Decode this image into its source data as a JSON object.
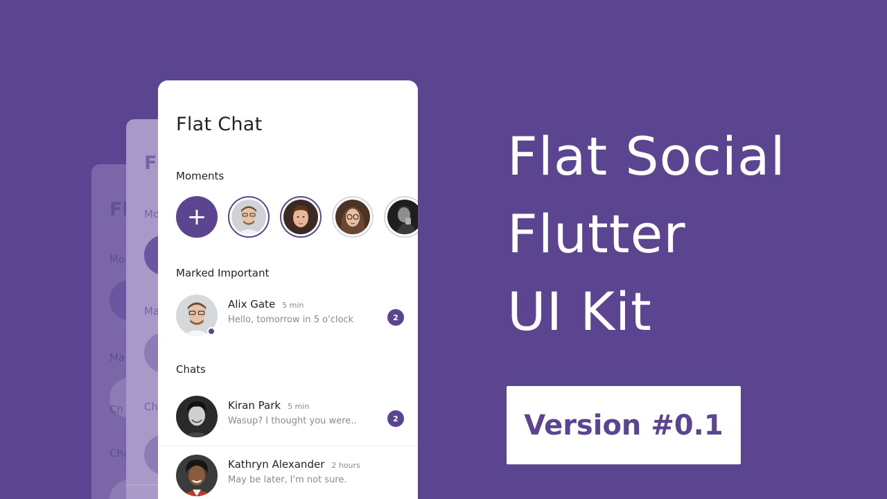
{
  "ghost_back": {
    "title_fragment": "Fl",
    "labels": [
      "Mo",
      "Ma",
      "Ch",
      "Cha"
    ]
  },
  "ghost_mid": {
    "title_fragment": "F",
    "labels": [
      "Mo",
      "Ma",
      "Ch"
    ]
  },
  "app": {
    "title": "Flat Chat",
    "moments_title": "Moments",
    "add_moment_icon": "+",
    "moments": [
      {
        "icon": "avatar-man-glasses",
        "seen": false
      },
      {
        "icon": "avatar-woman-brown-hair",
        "seen": false
      },
      {
        "icon": "avatar-woman-glasses",
        "seen": true
      },
      {
        "icon": "avatar-man-dark",
        "seen": true
      }
    ],
    "important_title": "Marked Important",
    "important": [
      {
        "name": "Alix Gate",
        "time": "5 min",
        "message": "Hello, tomorrow in 5 o'clock",
        "badge": "2",
        "online": true
      }
    ],
    "chats_title": "Chats",
    "chats": [
      {
        "name": "Kiran Park",
        "time": "5 min",
        "message": "Wasup? I thought you were..",
        "badge": "2"
      },
      {
        "name": "Kathryn Alexander",
        "time": "2 hours",
        "message": "May be later, I'm not sure.",
        "badge": ""
      }
    ]
  },
  "headline": {
    "line1": "Flat Social",
    "line2": "Flutter",
    "line3": "UI Kit"
  },
  "version": {
    "label": "Version #0.1"
  },
  "colors": {
    "primary": "#5b4590",
    "background": "#5b4590",
    "card": "#ffffff"
  }
}
